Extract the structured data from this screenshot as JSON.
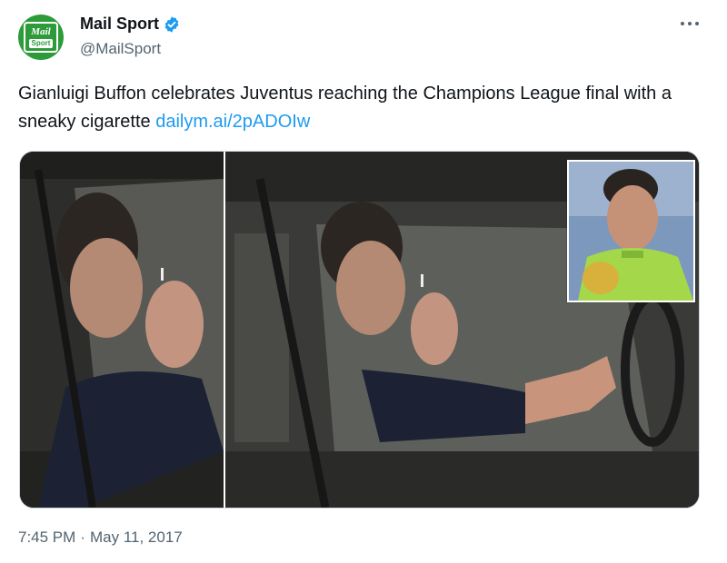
{
  "account": {
    "display_name": "Mail Sport",
    "handle": "@MailSport",
    "avatar_line1": "Mail",
    "avatar_line2": "Sport",
    "verified": true,
    "verified_color": "#1d9bf0",
    "brand_color": "#2e9b3b"
  },
  "tweet": {
    "text": "Gianluigi Buffon celebrates Juventus reaching the Champions League final with a sneaky cigarette ",
    "link_text": "dailym.ai/2pADOIw",
    "link_color": "#1d9bf0"
  },
  "media": {
    "photo_count": 2,
    "has_inset": true
  },
  "meta": {
    "time": "7:45 PM",
    "separator": "·",
    "date": "May 11, 2017"
  },
  "icons": {
    "more": "more-horizontal-icon",
    "verified": "verified-badge-icon"
  }
}
